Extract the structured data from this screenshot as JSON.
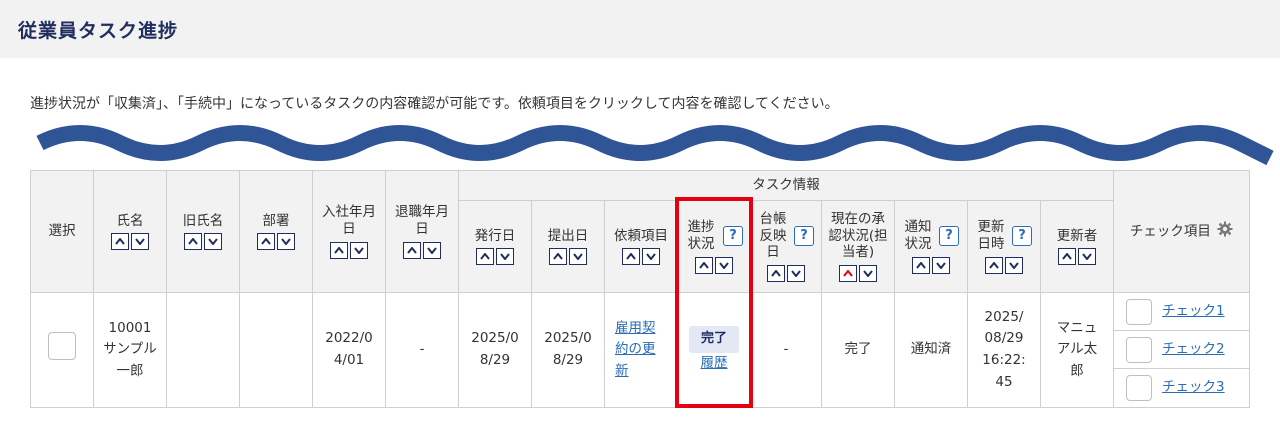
{
  "page": {
    "title": "従業員タスク進捗"
  },
  "description": "進捗状況が「収集済」、「手続中」になっているタスクの内容確認が可能です。依頼項目をクリックして内容を確認してください。",
  "table": {
    "headers": {
      "select": "選択",
      "name": "氏名",
      "old_name": "旧氏名",
      "department": "部署",
      "hire_date": "入社年月日",
      "retire_date": "退職年月日",
      "group_task": "タスク情報",
      "issue_date": "発行日",
      "submit_date": "提出日",
      "request_item": "依頼項目",
      "progress": "進捗状況",
      "ledger": "台帳反映日",
      "approval": "現在の承認状況(担当者)",
      "notify": "通知状況",
      "updated_at": "更新日時",
      "updated_by": "更新者",
      "check_items": "チェック項目"
    },
    "row": {
      "name": "10001 サンプル 一郎",
      "old_name": "",
      "department": "",
      "hire_date": "2022/04/01",
      "retire_date": "-",
      "issue_date": "2025/08/29",
      "submit_date": "2025/08/29",
      "request_item": "雇用契約の更新",
      "progress_badge": "完了",
      "progress_history": "履歴",
      "ledger": "-",
      "approval": "完了",
      "notify": "通知済",
      "updated_at": "2025/08/29 16:22:45",
      "updated_by": "マニュアル太郎",
      "checks": [
        "チェック1",
        "チェック2",
        "チェック3"
      ]
    }
  },
  "colors": {
    "navy": "#1f2d5f",
    "wave": "#2f5597",
    "highlight": "#e60012",
    "link": "#2a6cb5"
  }
}
